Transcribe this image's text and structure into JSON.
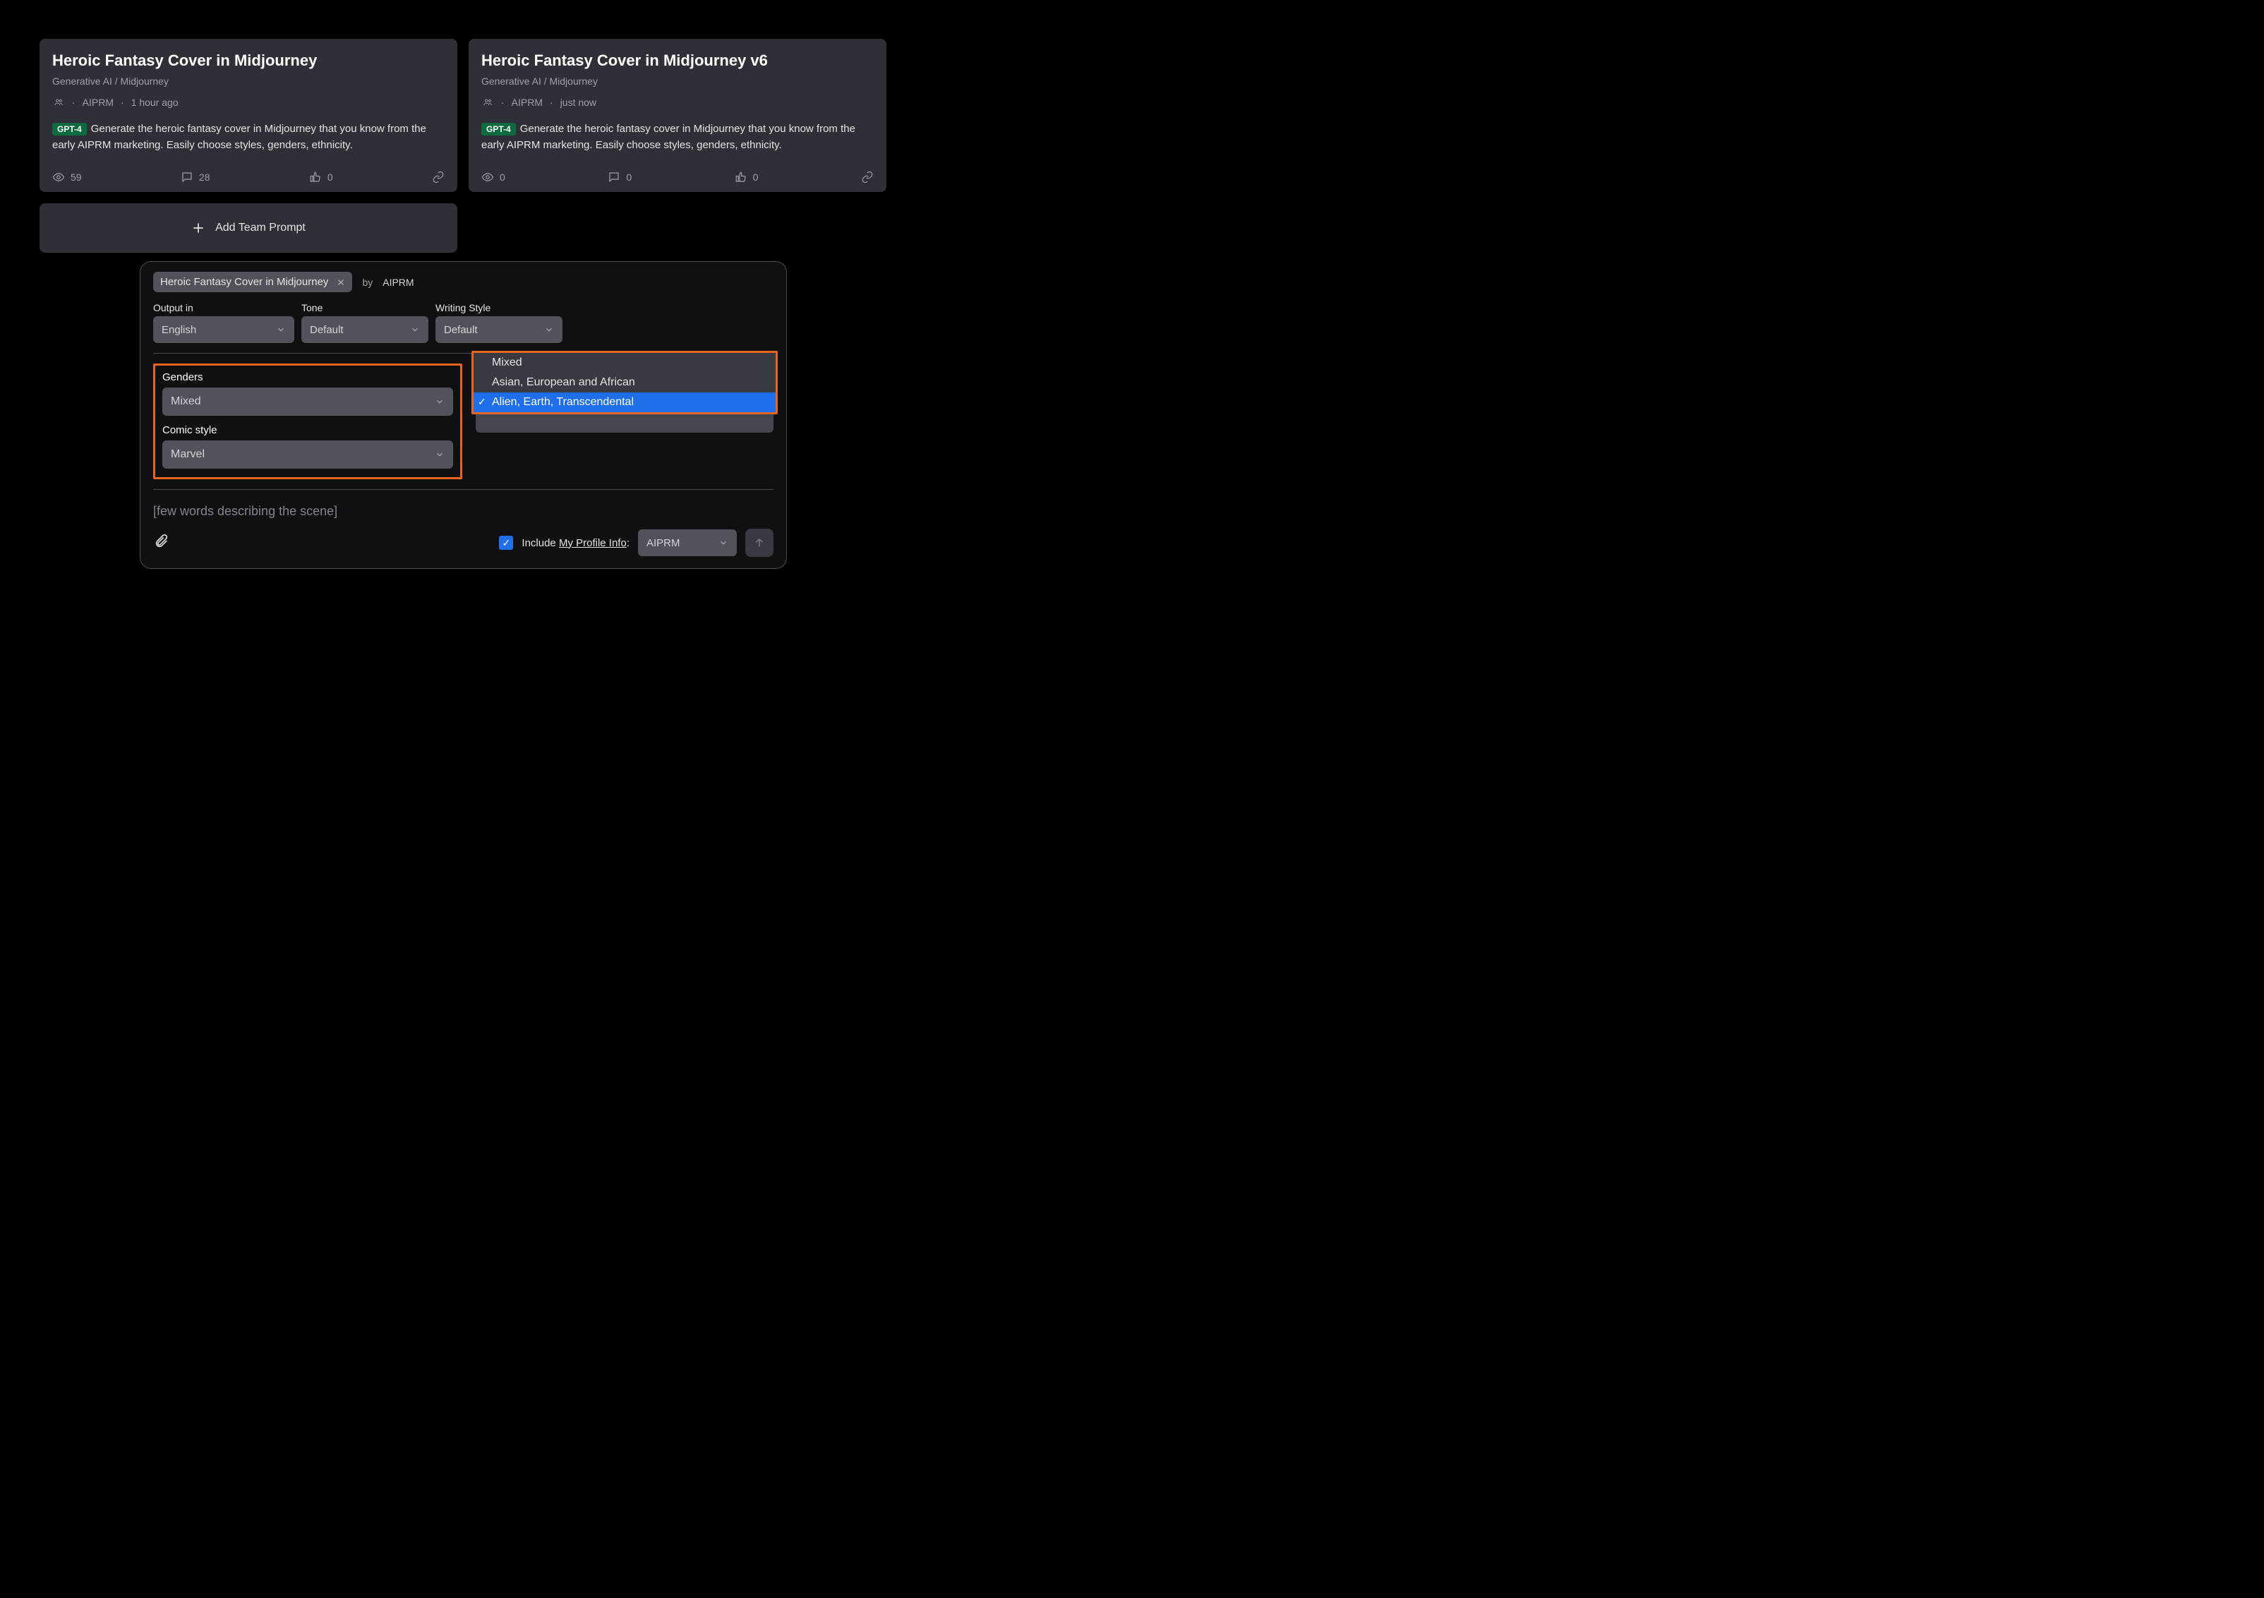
{
  "cards": [
    {
      "title": "Heroic Fantasy Cover in Midjourney",
      "subtitle": "Generative AI / Midjourney",
      "author": "AIPRM",
      "time": "1 hour ago",
      "badge": "GPT-4",
      "description": "Generate the heroic fantasy cover in Midjourney that you know from the early AIPRM marketing. Easily choose styles, genders, ethnicity.",
      "views": "59",
      "comments": "28",
      "likes": "0"
    },
    {
      "title": "Heroic Fantasy Cover in Midjourney v6",
      "subtitle": "Generative AI / Midjourney",
      "author": "AIPRM",
      "time": "just now",
      "badge": "GPT-4",
      "description": "Generate the heroic fantasy cover in Midjourney that you know from the early AIPRM marketing. Easily choose styles, genders, ethnicity.",
      "views": "0",
      "comments": "0",
      "likes": "0"
    }
  ],
  "add_prompt_label": "Add Team Prompt",
  "panel": {
    "chip_label": "Heroic Fantasy Cover in Midjourney",
    "by_label": "by",
    "by_author": "AIPRM",
    "selects": {
      "output_label": "Output in",
      "output_value": "English",
      "tone_label": "Tone",
      "tone_value": "Default",
      "writing_label": "Writing Style",
      "writing_value": "Default"
    },
    "custom": {
      "genders_label": "Genders",
      "genders_value": "Mixed",
      "comic_label": "Comic style",
      "comic_value": "Marvel"
    },
    "dropdown": {
      "items": [
        "Mixed",
        "Asian, European and African",
        "Alien, Earth, Transcendental"
      ]
    },
    "placeholder": "[few words describing the scene]",
    "footer": {
      "include_label_prefix": "Include ",
      "include_label_link": "My Profile Info",
      "include_label_suffix": ":",
      "author_value": "AIPRM"
    }
  }
}
